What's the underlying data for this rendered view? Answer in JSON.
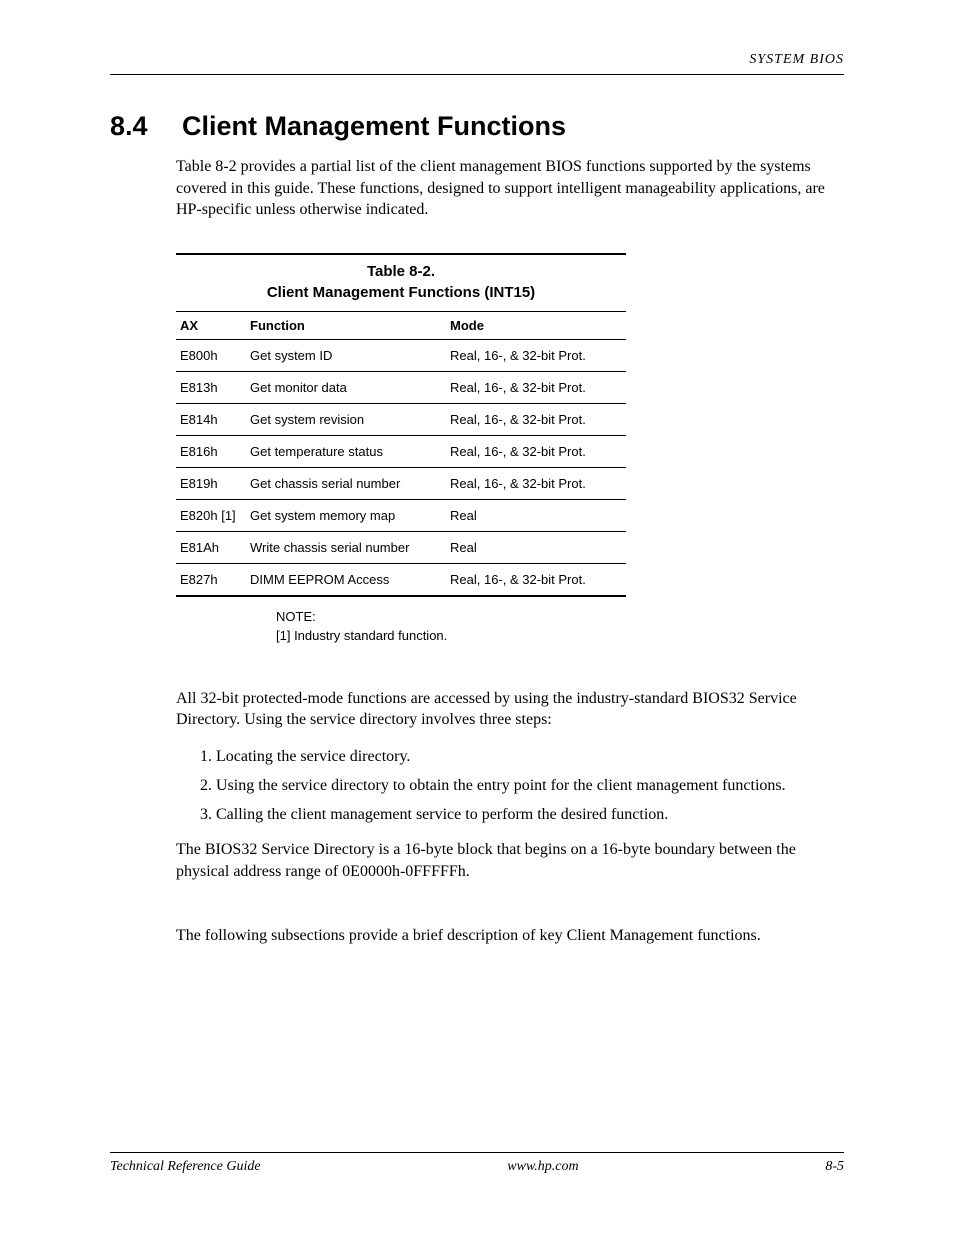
{
  "header": {
    "right": "SYSTEM BIOS"
  },
  "heading": {
    "number": "8.4",
    "title": "Client Management Functions"
  },
  "intro": "Table 8-2 provides a partial list of the client management BIOS functions supported by the systems covered in this guide. These functions, designed to support intelligent manageability applications, are HP-specific unless otherwise indicated.",
  "table": {
    "caption_line1": "Table 8-2.",
    "caption_line2": "Client Management Functions (INT15)",
    "headers": {
      "ax": "AX",
      "function": "Function",
      "mode": "Mode"
    },
    "rows": [
      {
        "ax": "E800h",
        "function": "Get system ID",
        "mode": "Real, 16-, & 32-bit Prot."
      },
      {
        "ax": "E813h",
        "function": "Get monitor data",
        "mode": "Real, 16-, & 32-bit Prot."
      },
      {
        "ax": "E814h",
        "function": "Get system revision",
        "mode": "Real, 16-, & 32-bit Prot."
      },
      {
        "ax": "E816h",
        "function": "Get temperature status",
        "mode": "Real, 16-, & 32-bit Prot."
      },
      {
        "ax": "E819h",
        "function": "Get chassis serial number",
        "mode": "Real, 16-, & 32-bit Prot."
      },
      {
        "ax": "E820h [1]",
        "function": "Get system memory map",
        "mode": "Real"
      },
      {
        "ax": "E81Ah",
        "function": "Write chassis serial number",
        "mode": "Real"
      },
      {
        "ax": "E827h",
        "function": "DIMM EEPROM Access",
        "mode": "Real, 16-, & 32-bit Prot."
      }
    ]
  },
  "note": {
    "label": "NOTE:",
    "text": "[1] Industry standard function."
  },
  "para_bios32": "All 32-bit protected-mode functions are accessed by using the industry-standard BIOS32 Service Directory.  Using the service directory involves three steps:",
  "steps": [
    "Locating the service directory.",
    "Using the service directory to obtain the entry point for the client management functions.",
    "Calling the client management service to perform the desired function."
  ],
  "para_block": "The BIOS32 Service Directory is a 16-byte block that begins on a 16-byte boundary between the physical address range of 0E0000h-0FFFFFh.",
  "para_subs": "The following subsections provide a brief description of key Client Management functions.",
  "footer": {
    "left": "Technical Reference Guide",
    "center": "www.hp.com",
    "right": "8-5"
  }
}
